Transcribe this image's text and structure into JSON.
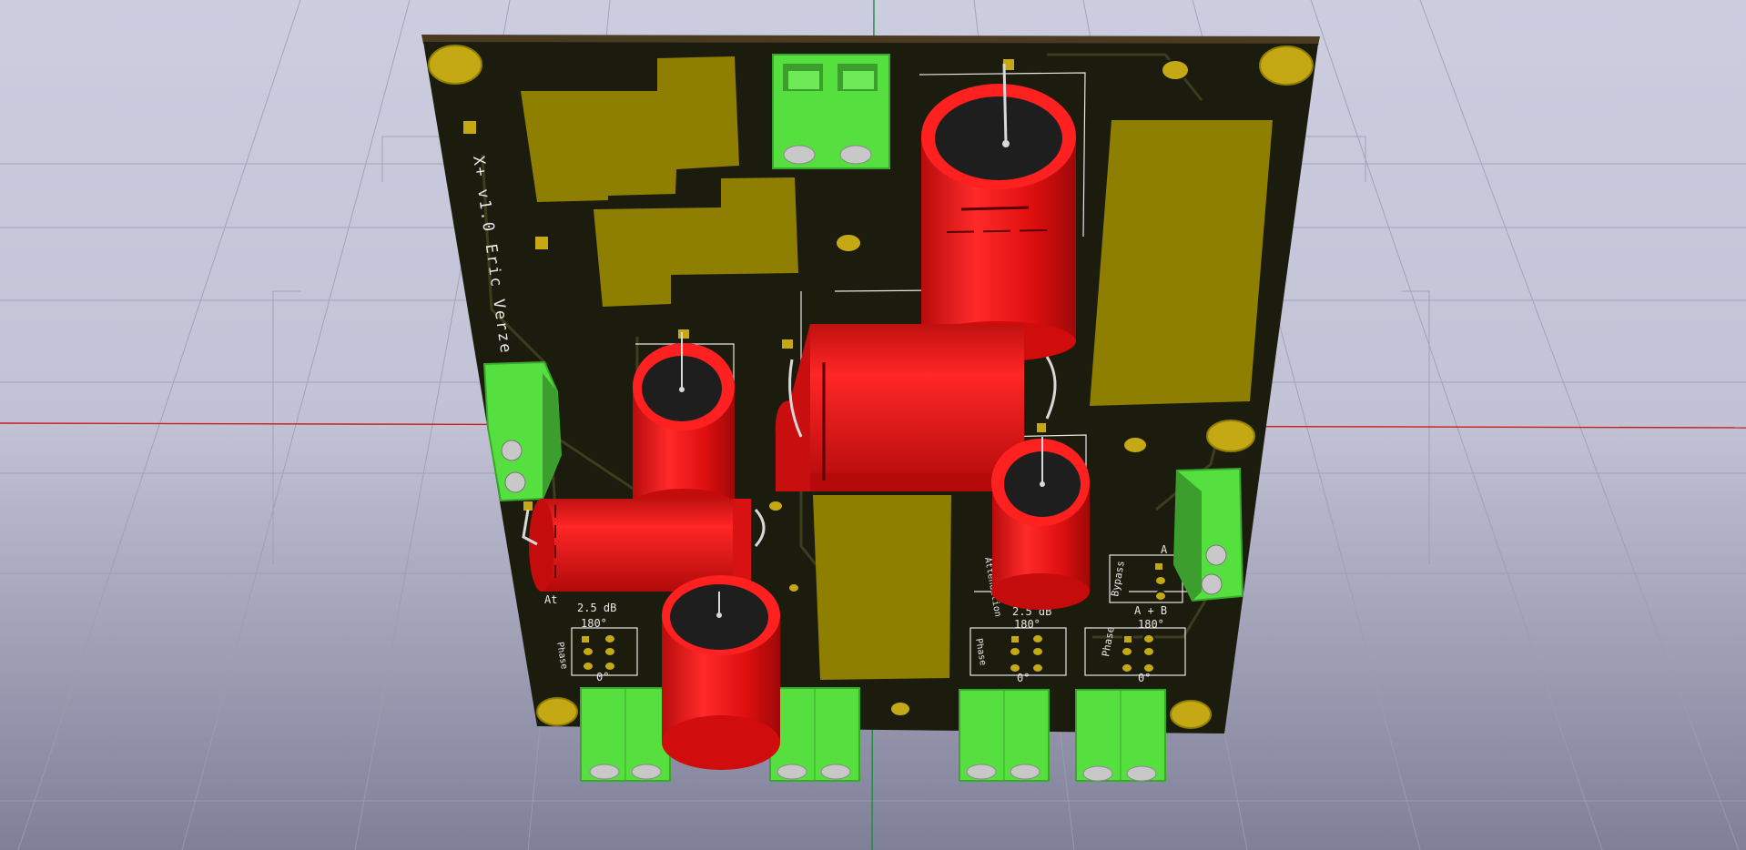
{
  "viewer": {
    "background_top": "#cdcde0",
    "background_bottom": "#7f7f98",
    "grid_color": "#9c9cb4",
    "axis_x_color": "#c81e1e",
    "axis_y_color": "#1e8c3c"
  },
  "board": {
    "substrate_color": "#1b1b0e",
    "edge_color": "#4a3a22",
    "copper_color": "#8f7f00",
    "pad_color": "#c4a814",
    "silkscreen_color": "#e8e8e8",
    "title_text": "X+ v1.0 Eric Verze 2015"
  },
  "components": {
    "capacitor_color": "#e11414",
    "terminal_block_color": "#56e040",
    "capacitor_top_color": "#1e1e1e",
    "lead_color": "#d8d8d8"
  },
  "silkscreen_labels": {
    "left_gain": "2.5 dB",
    "left_phase_top": "180°",
    "left_phase_label": "Phase",
    "left_phase_bottom": "0°",
    "left_prefix": "At",
    "right_attenuation": "Attenuation",
    "right_gain": "2.5 dB",
    "right_phase_top": "180°",
    "right_phase_label": "Phase",
    "right_phase_bottom": "0°",
    "bypass_label": "Bypass",
    "bypass_a": "A",
    "bypass_ab": "A + B",
    "far_phase_top": "180°",
    "far_phase_label": "Phase",
    "far_phase_bottom": "0°"
  }
}
